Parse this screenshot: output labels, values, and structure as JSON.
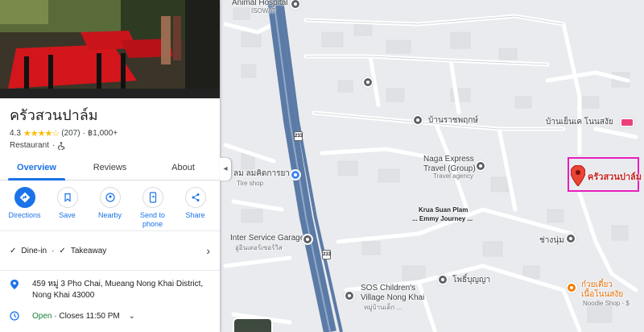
{
  "place": {
    "name": "ครัวสวนปาล์ม",
    "rating": "4.3",
    "stars": "★★★★☆",
    "reviews": "(207)",
    "price": "฿1,000+",
    "category": "Restaurant",
    "accessibility_icon": "wheelchair-icon"
  },
  "tabs": [
    {
      "label": "Overview",
      "active": true
    },
    {
      "label": "Reviews",
      "active": false
    },
    {
      "label": "About",
      "active": false
    }
  ],
  "actions": [
    {
      "label": "Directions",
      "icon": "directions-icon"
    },
    {
      "label": "Save",
      "icon": "bookmark-icon"
    },
    {
      "label": "Nearby",
      "icon": "nearby-icon"
    },
    {
      "label": "Send to phone",
      "icon": "phone-icon"
    },
    {
      "label": "Share",
      "icon": "share-icon"
    }
  ],
  "services": {
    "dine_in": "Dine-in",
    "takeaway": "Takeaway"
  },
  "address": "459 หมู่ 3 Pho Chai, Mueang Nong Khai District, Nong Khai 43000",
  "hours": {
    "status": "Open",
    "closes": "· Closes 11:50 PM"
  },
  "map": {
    "labels": {
      "animal_hospital": "Animal Hospital",
      "animal_hospital_sub": "ISOWAT",
      "baan_ratchaphruek": "บ้านราชพฤกษ์",
      "naga_express": "Naga Express\nTravel (Group)",
      "travel_agency": "Travel agency",
      "baan_yen": "บ้านเย็นเค โนนสงัย",
      "tire_shop_th": "ลม ลมคิดการยาง",
      "tire_shop": "Tire shop",
      "krua_suan_plam": "Krua Suan Plam",
      "emmy_journey": "... Emmy Journey ...",
      "inter_service": "Inter Service Garage",
      "inter_service_sub": "อู่อินเตอร์เซอร์วิส",
      "chang_num": "ช่างนุ่ม",
      "sos_village": "SOS Children's\nVillage Nong Khai",
      "sos_sub": "หมู่บ้านเด็ก ...",
      "pho_bunya": "โพธิ์บุญญา",
      "noodle_th": "ก๋วยเตี๋ยว\nเนื้อโนนสงัย",
      "noodle": "Noodle Shop · $",
      "destination": "ครัวสวนปาล์ม",
      "route_233": "233"
    }
  }
}
